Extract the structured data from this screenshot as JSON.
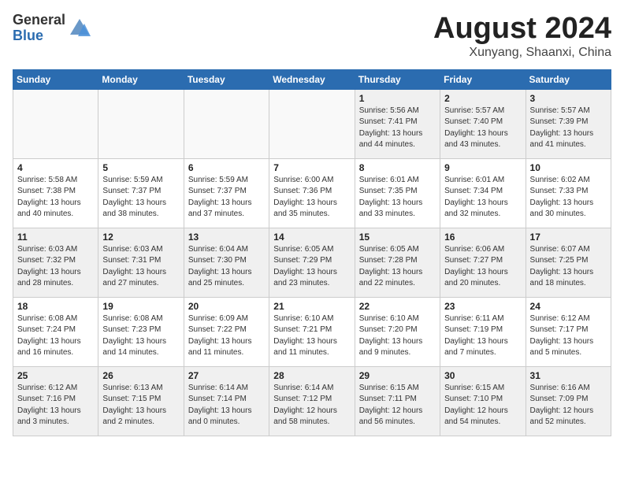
{
  "logo": {
    "general": "General",
    "blue": "Blue"
  },
  "title": "August 2024",
  "location": "Xunyang, Shaanxi, China",
  "weekdays": [
    "Sunday",
    "Monday",
    "Tuesday",
    "Wednesday",
    "Thursday",
    "Friday",
    "Saturday"
  ],
  "weeks": [
    [
      {
        "day": "",
        "empty": true
      },
      {
        "day": "",
        "empty": true
      },
      {
        "day": "",
        "empty": true
      },
      {
        "day": "",
        "empty": true
      },
      {
        "day": "1",
        "sunrise": "5:56 AM",
        "sunset": "7:41 PM",
        "daylight": "13 hours and 44 minutes."
      },
      {
        "day": "2",
        "sunrise": "5:57 AM",
        "sunset": "7:40 PM",
        "daylight": "13 hours and 43 minutes."
      },
      {
        "day": "3",
        "sunrise": "5:57 AM",
        "sunset": "7:39 PM",
        "daylight": "13 hours and 41 minutes."
      }
    ],
    [
      {
        "day": "4",
        "sunrise": "5:58 AM",
        "sunset": "7:38 PM",
        "daylight": "13 hours and 40 minutes."
      },
      {
        "day": "5",
        "sunrise": "5:59 AM",
        "sunset": "7:37 PM",
        "daylight": "13 hours and 38 minutes."
      },
      {
        "day": "6",
        "sunrise": "5:59 AM",
        "sunset": "7:37 PM",
        "daylight": "13 hours and 37 minutes."
      },
      {
        "day": "7",
        "sunrise": "6:00 AM",
        "sunset": "7:36 PM",
        "daylight": "13 hours and 35 minutes."
      },
      {
        "day": "8",
        "sunrise": "6:01 AM",
        "sunset": "7:35 PM",
        "daylight": "13 hours and 33 minutes."
      },
      {
        "day": "9",
        "sunrise": "6:01 AM",
        "sunset": "7:34 PM",
        "daylight": "13 hours and 32 minutes."
      },
      {
        "day": "10",
        "sunrise": "6:02 AM",
        "sunset": "7:33 PM",
        "daylight": "13 hours and 30 minutes."
      }
    ],
    [
      {
        "day": "11",
        "sunrise": "6:03 AM",
        "sunset": "7:32 PM",
        "daylight": "13 hours and 28 minutes."
      },
      {
        "day": "12",
        "sunrise": "6:03 AM",
        "sunset": "7:31 PM",
        "daylight": "13 hours and 27 minutes."
      },
      {
        "day": "13",
        "sunrise": "6:04 AM",
        "sunset": "7:30 PM",
        "daylight": "13 hours and 25 minutes."
      },
      {
        "day": "14",
        "sunrise": "6:05 AM",
        "sunset": "7:29 PM",
        "daylight": "13 hours and 23 minutes."
      },
      {
        "day": "15",
        "sunrise": "6:05 AM",
        "sunset": "7:28 PM",
        "daylight": "13 hours and 22 minutes."
      },
      {
        "day": "16",
        "sunrise": "6:06 AM",
        "sunset": "7:27 PM",
        "daylight": "13 hours and 20 minutes."
      },
      {
        "day": "17",
        "sunrise": "6:07 AM",
        "sunset": "7:25 PM",
        "daylight": "13 hours and 18 minutes."
      }
    ],
    [
      {
        "day": "18",
        "sunrise": "6:08 AM",
        "sunset": "7:24 PM",
        "daylight": "13 hours and 16 minutes."
      },
      {
        "day": "19",
        "sunrise": "6:08 AM",
        "sunset": "7:23 PM",
        "daylight": "13 hours and 14 minutes."
      },
      {
        "day": "20",
        "sunrise": "6:09 AM",
        "sunset": "7:22 PM",
        "daylight": "13 hours and 11 minutes."
      },
      {
        "day": "21",
        "sunrise": "6:10 AM",
        "sunset": "7:21 PM",
        "daylight": "13 hours and 11 minutes."
      },
      {
        "day": "22",
        "sunrise": "6:10 AM",
        "sunset": "7:20 PM",
        "daylight": "13 hours and 9 minutes."
      },
      {
        "day": "23",
        "sunrise": "6:11 AM",
        "sunset": "7:19 PM",
        "daylight": "13 hours and 7 minutes."
      },
      {
        "day": "24",
        "sunrise": "6:12 AM",
        "sunset": "7:17 PM",
        "daylight": "13 hours and 5 minutes."
      }
    ],
    [
      {
        "day": "25",
        "sunrise": "6:12 AM",
        "sunset": "7:16 PM",
        "daylight": "13 hours and 3 minutes."
      },
      {
        "day": "26",
        "sunrise": "6:13 AM",
        "sunset": "7:15 PM",
        "daylight": "13 hours and 2 minutes."
      },
      {
        "day": "27",
        "sunrise": "6:14 AM",
        "sunset": "7:14 PM",
        "daylight": "13 hours and 0 minutes."
      },
      {
        "day": "28",
        "sunrise": "6:14 AM",
        "sunset": "7:12 PM",
        "daylight": "12 hours and 58 minutes."
      },
      {
        "day": "29",
        "sunrise": "6:15 AM",
        "sunset": "7:11 PM",
        "daylight": "12 hours and 56 minutes."
      },
      {
        "day": "30",
        "sunrise": "6:15 AM",
        "sunset": "7:10 PM",
        "daylight": "12 hours and 54 minutes."
      },
      {
        "day": "31",
        "sunrise": "6:16 AM",
        "sunset": "7:09 PM",
        "daylight": "12 hours and 52 minutes."
      }
    ]
  ],
  "labels": {
    "sunrise": "Sunrise:",
    "sunset": "Sunset:",
    "daylight": "Daylight:"
  }
}
